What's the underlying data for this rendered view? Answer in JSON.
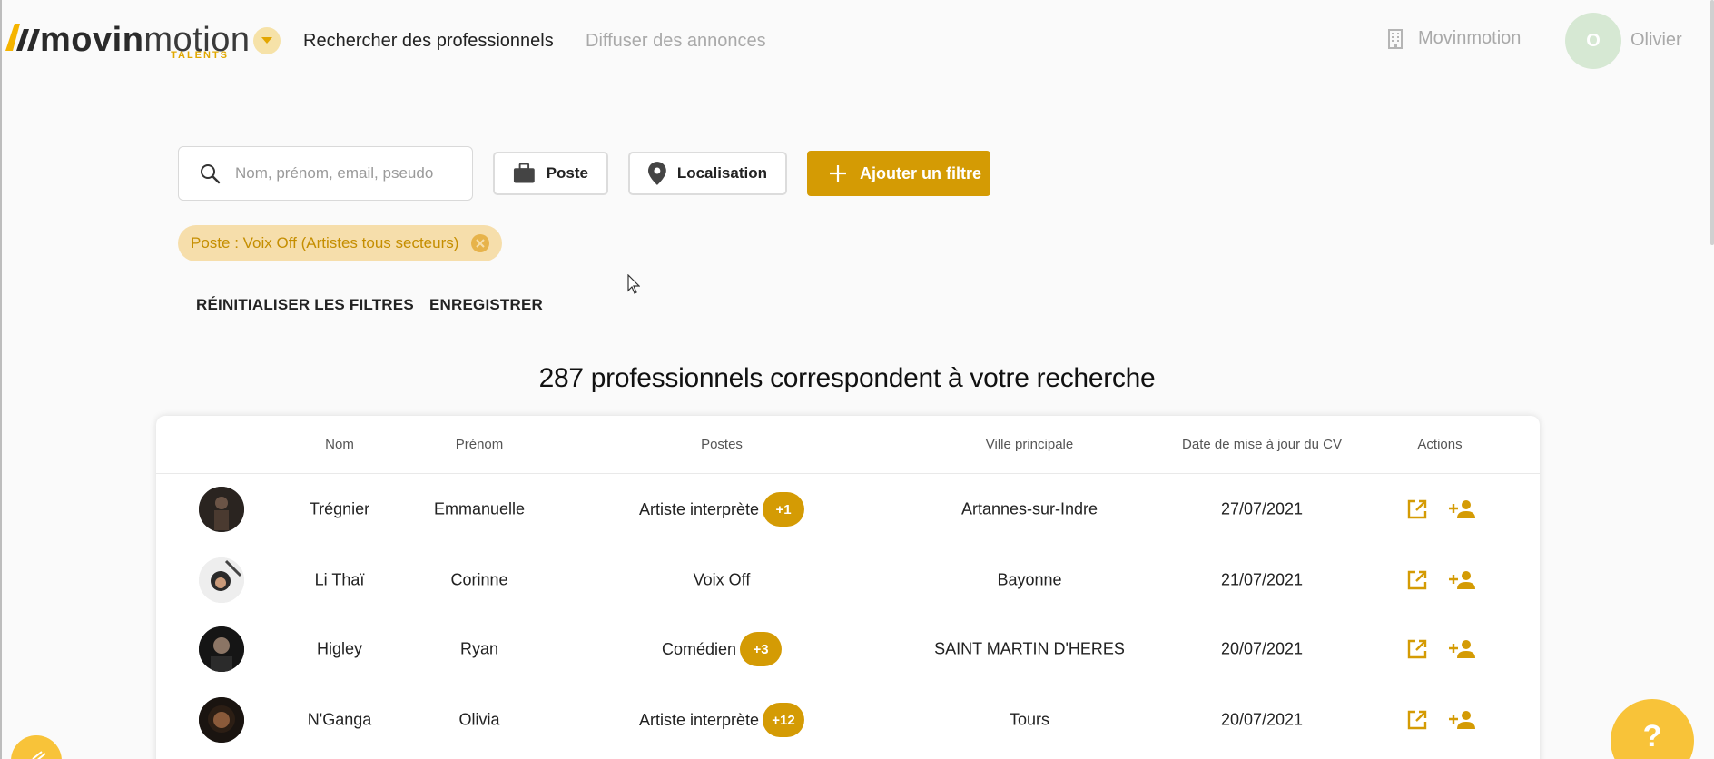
{
  "header": {
    "logo_main_bold": "movin",
    "logo_main_thin": "motion",
    "logo_sub": "TALENTS",
    "nav": [
      {
        "label": "Rechercher des professionnels",
        "active": true
      },
      {
        "label": "Diffuser des annonces",
        "active": false
      }
    ],
    "org_name": "Movinmotion",
    "user_initial": "O",
    "user_name": "Olivier"
  },
  "filters": {
    "search_placeholder": "Nom, prénom, email, pseudo",
    "poste_label": "Poste",
    "location_label": "Localisation",
    "add_filter_label": "Ajouter un filtre",
    "active_chip": "Poste : Voix Off (Artistes tous secteurs)",
    "reset_label": "RÉINITIALISER LES FILTRES",
    "save_label": "ENREGISTRER"
  },
  "results": {
    "title": "287 professionnels correspondent à votre recherche"
  },
  "table": {
    "headers": {
      "nom": "Nom",
      "prenom": "Prénom",
      "postes": "Postes",
      "ville": "Ville principale",
      "date": "Date de mise à jour du CV",
      "actions": "Actions"
    },
    "rows": [
      {
        "nom": "Trégnier",
        "prenom": "Emmanuelle",
        "poste": "Artiste interprète",
        "extra": "+1",
        "ville": "Artannes-sur-Indre",
        "date": "27/07/2021"
      },
      {
        "nom": "Li Thaï",
        "prenom": "Corinne",
        "poste": "Voix Off",
        "extra": "",
        "ville": "Bayonne",
        "date": "21/07/2021"
      },
      {
        "nom": "Higley",
        "prenom": "Ryan",
        "poste": "Comédien",
        "extra": "+3",
        "ville": "SAINT MARTIN D'HERES",
        "date": "20/07/2021"
      },
      {
        "nom": "N'Ganga",
        "prenom": "Olivia",
        "poste": "Artiste interprète",
        "extra": "+12",
        "ville": "Tours",
        "date": "20/07/2021"
      }
    ]
  },
  "help": {
    "label": "?"
  },
  "colors": {
    "accent": "#d49b04",
    "chip_bg": "#f6deab",
    "chip_text": "#c58e00"
  }
}
